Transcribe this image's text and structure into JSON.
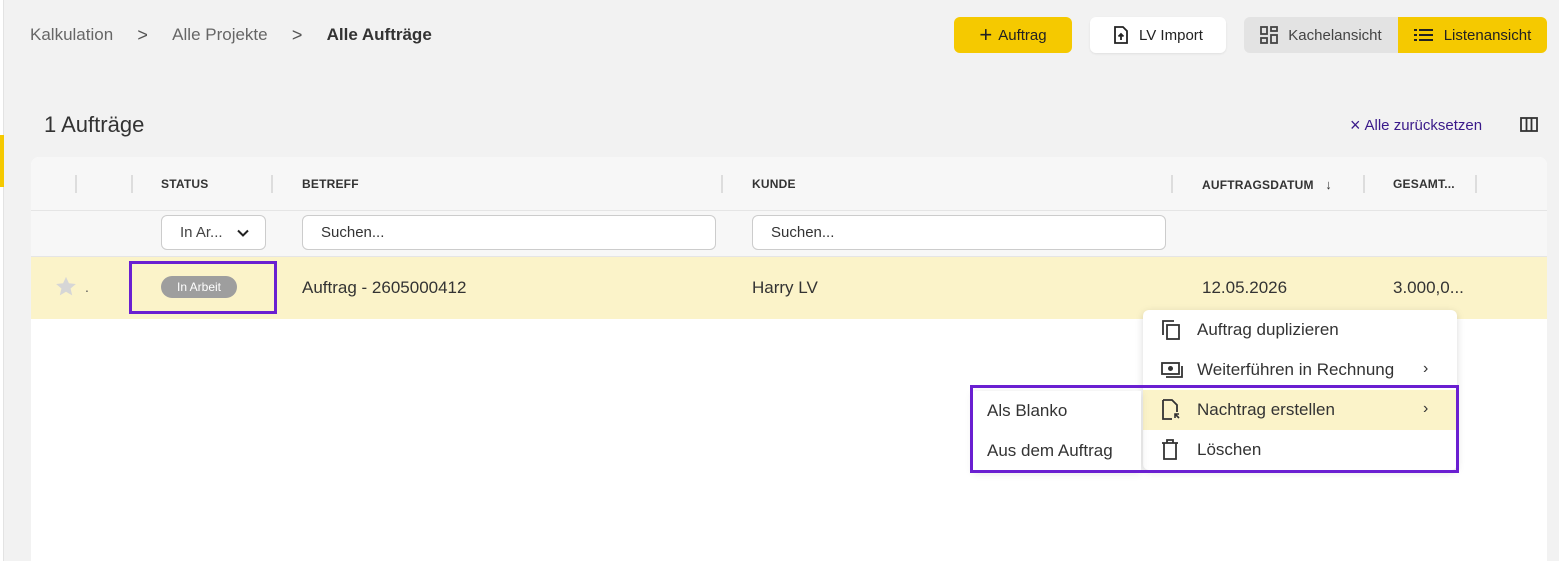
{
  "breadcrumb": {
    "items": [
      "Kalkulation",
      "Alle Projekte",
      "Alle Aufträge"
    ],
    "separator": ">"
  },
  "toolbar": {
    "add_label": "Auftrag",
    "import_label": "LV Import",
    "view_tiles_label": "Kachelansicht",
    "view_list_label": "Listenansicht",
    "active_view": "Listenansicht"
  },
  "list": {
    "count_label": "1 Aufträge",
    "reset_label": "Alle zurücksetzen"
  },
  "table": {
    "columns": [
      "STATUS",
      "BETREFF",
      "KUNDE",
      "AUFTRAGSDATUM",
      "GESAMT..."
    ],
    "sort_column": "AUFTRAGSDATUM",
    "sort_direction": "descending",
    "filters": {
      "status_value": "In Ar...",
      "betreff_placeholder": "Suchen...",
      "kunde_placeholder": "Suchen..."
    },
    "rows": [
      {
        "dot": ".",
        "status": "In Arbeit",
        "betreff": "Auftrag - 2605000412",
        "kunde": "Harry LV",
        "auftragsdatum": "12.05.2026",
        "gesamt": "3.000,0..."
      }
    ]
  },
  "context_menu": {
    "items": [
      {
        "label": "Auftrag duplizieren",
        "icon": "copy-icon"
      },
      {
        "label": "Weiterführen in Rechnung",
        "icon": "invoice-icon",
        "has_submenu": true
      },
      {
        "label": "Nachtrag erstellen",
        "icon": "document-add-icon",
        "has_submenu": true,
        "active": true
      },
      {
        "label": "Löschen",
        "icon": "trash-icon"
      }
    ],
    "submenu": [
      "Als Blanko",
      "Aus dem Auftrag"
    ]
  },
  "colors": {
    "accent": "#f5c900",
    "row_highlight": "#fbf3c9",
    "link": "#3a1a8a",
    "annotation_border": "#6a1fd1",
    "status_badge": "#9e9e9e"
  }
}
